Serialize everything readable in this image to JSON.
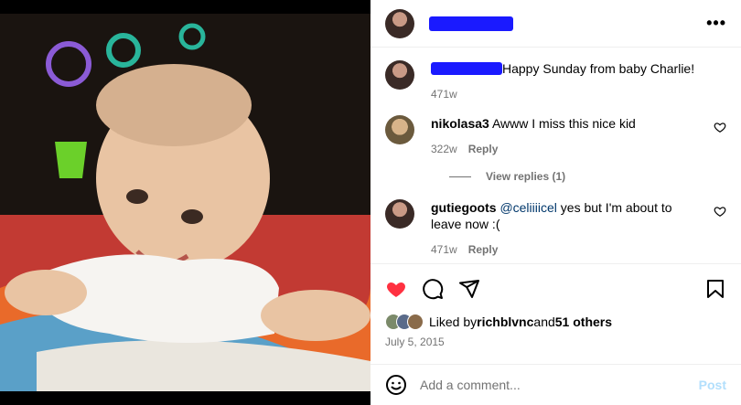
{
  "post": {
    "author_redacted": true,
    "more_icon": "more-horizontal-icon"
  },
  "caption": {
    "text": "Happy Sunday from baby Charlie!",
    "age": "471w"
  },
  "comments": [
    {
      "username": "nikolasa3",
      "text": "Awww I miss this nice kid",
      "age": "322w",
      "reply_label": "Reply",
      "view_replies": "View replies (1)"
    },
    {
      "username": "gutiegoots",
      "mention": "@celiiiicel",
      "text": " yes but I'm about to leave now :(",
      "age": "471w",
      "reply_label": "Reply"
    }
  ],
  "actions": {
    "like_icon": "heart-filled-icon",
    "comment_icon": "comment-icon",
    "share_icon": "share-icon",
    "save_icon": "bookmark-icon",
    "like_color": "#ff3040"
  },
  "likes": {
    "prefix": "Liked by ",
    "user": "richblvnc",
    "and": " and ",
    "others": "51 others"
  },
  "date": "July 5, 2015",
  "composer": {
    "placeholder": "Add a comment...",
    "post_label": "Post"
  }
}
